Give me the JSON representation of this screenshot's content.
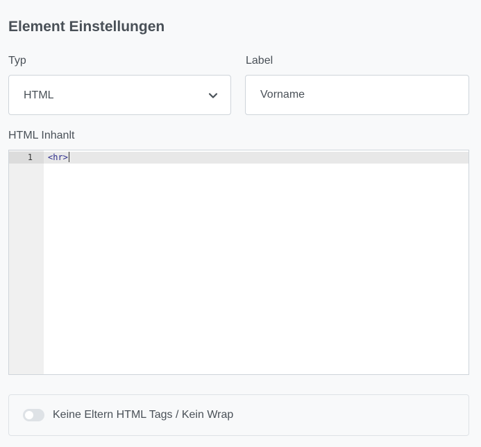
{
  "section": {
    "title": "Element Einstellungen"
  },
  "type_field": {
    "label": "Typ",
    "selected": "HTML",
    "icon": "chevron-down-icon"
  },
  "label_field": {
    "label": "Label",
    "value": "Vorname"
  },
  "html_content": {
    "label": "HTML Inhanlt",
    "line_number": "1",
    "code": "<hr>"
  },
  "options": {
    "no_wrap_label": "Keine Eltern HTML Tags / Kein Wrap",
    "no_wrap_enabled": false
  },
  "colors": {
    "text": "#495057",
    "border": "#ced4da",
    "background": "#f8f9fa",
    "code": "#2a2a8a"
  }
}
